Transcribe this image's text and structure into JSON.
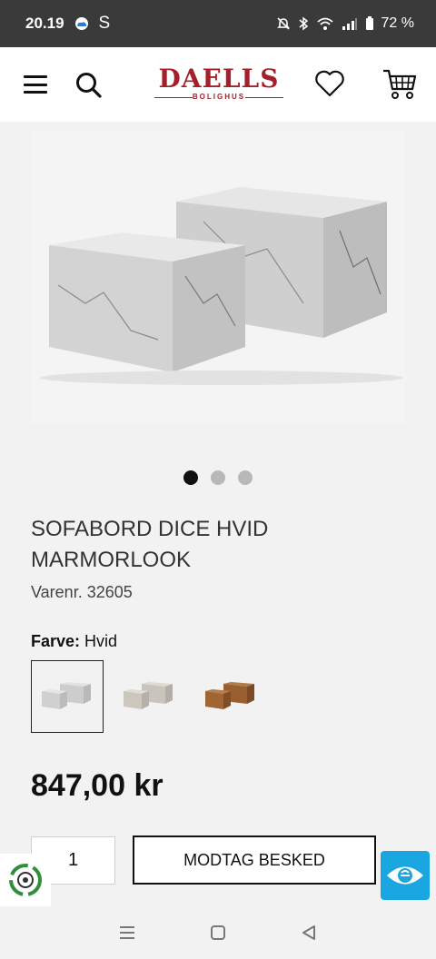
{
  "status": {
    "time": "20.19",
    "carrier_letter": "S",
    "battery": "72 %"
  },
  "header": {
    "logo_main": "DAELLS",
    "logo_sub": "BOLIGHUS"
  },
  "product": {
    "title": "SOFABORD DICE HVID MARMORLOOK",
    "sku": "Varenr. 32605",
    "color_label": "Farve:",
    "color_value": "Hvid",
    "swatches": [
      "white-marble",
      "grey-concrete",
      "brown-rust"
    ],
    "selected_swatch": 0,
    "price": "847,00 kr",
    "quantity": "1",
    "cta_label": "MODTAG BESKED"
  },
  "gallery": {
    "image_count": 3,
    "active_index": 0
  },
  "colors": {
    "brand": "#a3202a",
    "eye_badge": "#1aa6e0"
  }
}
